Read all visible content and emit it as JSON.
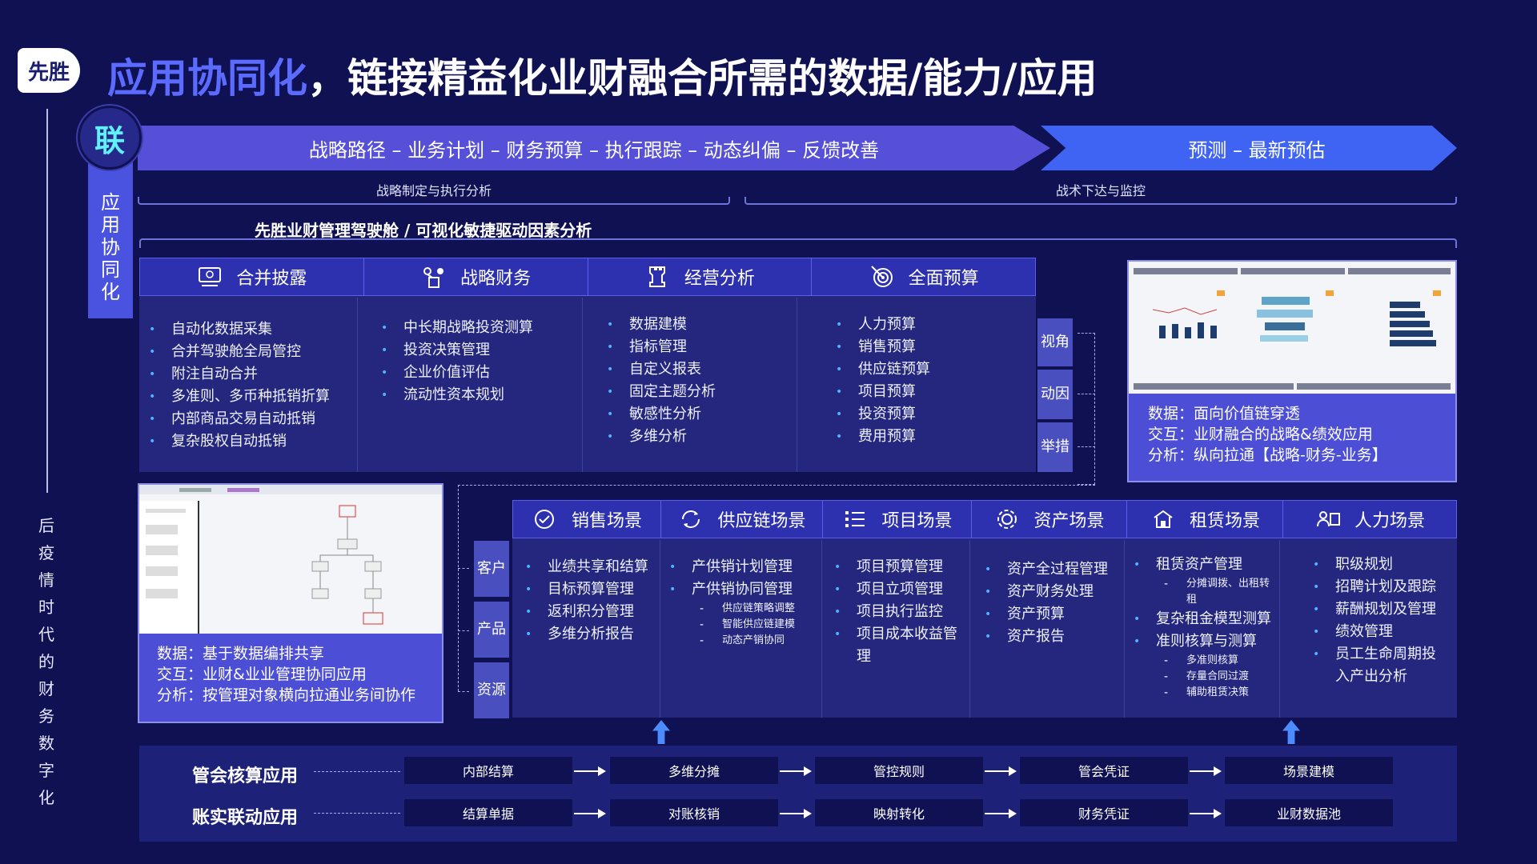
{
  "header": {
    "logo": "先胜",
    "title_highlight": "应用协同化",
    "title_rest": "，链接精益化业财融合所需的数据/能力/应用"
  },
  "side": {
    "vertical_text": [
      "后",
      "疫",
      "情",
      "时",
      "代",
      "的",
      "财",
      "务",
      "数",
      "字",
      "化"
    ]
  },
  "lian": "联",
  "app_sync": [
    "应",
    "用",
    "协",
    "同",
    "化"
  ],
  "arrows": {
    "main": "战略路径 – 业务计划 – 财务预算 –  执行跟踪 – 动态纠偏  – 反馈改善",
    "forecast": "预测  –  最新预估"
  },
  "brace_labels": {
    "left": "战略制定与执行分析",
    "right": "战术下达与监控"
  },
  "cockpit": "先胜业财管理驾驶舱 / 可视化敏捷驱动因素分析",
  "top_modules": [
    {
      "title": "合并披露",
      "icon": "monitor-icon",
      "items": [
        "自动化数据采集",
        "合并驾驶舱全局管控",
        "附注自动合并",
        "多准则、多币种抵销折算",
        "内部商品交易自动抵销",
        "复杂股权自动抵销"
      ]
    },
    {
      "title": "战略财务",
      "icon": "strategy-icon",
      "items": [
        "中长期战略投资测算",
        "投资决策管理",
        "企业价值评估",
        "流动性资本规划"
      ]
    },
    {
      "title": "经营分析",
      "icon": "chess-icon",
      "items": [
        "数据建模",
        "指标管理",
        "自定义报表",
        "固定主题分析",
        "敏感性分析",
        "多维分析"
      ]
    },
    {
      "title": "全面预算",
      "icon": "target-icon",
      "items": [
        "人力预算",
        "销售预算",
        "供应链预算",
        "项目预算",
        "投资预算",
        "费用预算"
      ]
    }
  ],
  "right_tags": [
    "视角",
    "动因",
    "举措"
  ],
  "dashboard_info": [
    "数据：面向价值链穿透",
    "交互：业财融合的战略&绩效应用",
    "分析：纵向拉通【战略-财务-业务】"
  ],
  "flow_info": [
    "数据：基于数据编排共享",
    "交互：业财&业业管理协同应用",
    "分析：按管理对象横向拉通业务间协作"
  ],
  "left_tags": [
    "客户",
    "产品",
    "资源"
  ],
  "scenes": [
    {
      "title": "销售场景",
      "icon": "sales-icon",
      "items": [
        [
          "业绩共享和结算"
        ],
        [
          "目标预算管理"
        ],
        [
          "返利积分管理"
        ],
        [
          "多维分析报告"
        ]
      ]
    },
    {
      "title": "供应链场景",
      "icon": "supply-icon",
      "items": [
        [
          "产供销计划管理"
        ],
        [
          "产供销协同管理",
          "供应链策略调整",
          "智能供应链建模",
          "动态产销协同"
        ]
      ]
    },
    {
      "title": "项目场景",
      "icon": "project-icon",
      "items": [
        [
          "项目预算管理"
        ],
        [
          "项目立项管理"
        ],
        [
          "项目执行监控"
        ],
        [
          "项目成本收益管理"
        ]
      ]
    },
    {
      "title": "资产场景",
      "icon": "asset-icon",
      "items": [
        [
          "资产全过程管理"
        ],
        [
          "资产财务处理"
        ],
        [
          "资产预算"
        ],
        [
          "资产报告"
        ]
      ]
    },
    {
      "title": "租赁场景",
      "icon": "lease-icon",
      "items": [
        [
          "租赁资产管理",
          "分摊调拨、出租转租"
        ],
        [
          "复杂租金模型测算"
        ],
        [
          "准则核算与测算",
          "多准则核算",
          "存量合同过渡",
          "辅助租赁决策"
        ]
      ]
    },
    {
      "title": "人力场景",
      "icon": "hr-icon",
      "items": [
        [
          "职级规划"
        ],
        [
          "招聘计划及跟踪"
        ],
        [
          "薪酬规划及管理"
        ],
        [
          "绩效管理"
        ],
        [
          "员工生命周期投入产出分析"
        ]
      ]
    }
  ],
  "bottom": {
    "row1": {
      "label": "管会核算应用",
      "steps": [
        "内部结算",
        "多维分摊",
        "管控规则",
        "管会凭证",
        "场景建模"
      ]
    },
    "row2": {
      "label": "账实联动应用",
      "steps": [
        "结算单据",
        "对账核销",
        "映射转化",
        "财务凭证",
        "业财数据池"
      ]
    }
  }
}
